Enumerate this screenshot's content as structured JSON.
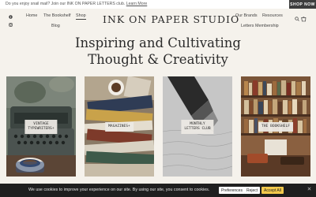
{
  "announcement": {
    "text": "Do you enjoy snail mail? Join our INK ON PAPER LETTERS club.",
    "link": "Learn More"
  },
  "shop_now": "SHOP NOW",
  "nav_left": {
    "home": "Home",
    "bookshelf": "The Bookshelf",
    "shop": "Shop",
    "blog": "Blog"
  },
  "logo": "INK ON PAPER STUDIO",
  "nav_right": {
    "brands": "Our Brands",
    "resources": "Resources",
    "membership": "Letters Membership"
  },
  "cart_count": "0",
  "hero": {
    "line1": "Inspiring and Cultivating",
    "line2": "Thought & Creativity"
  },
  "cards": [
    {
      "line1": "VINTAGE",
      "line2": "TYPEWRITERS+"
    },
    {
      "line1": "MAGAZINES+",
      "line2": ""
    },
    {
      "line1": "MONTHLY",
      "line2": "LETTERS CLUB"
    },
    {
      "line1": "THE BOOKSHELF",
      "line2": ""
    }
  ],
  "cookie": {
    "text": "We use cookies to improve your experience on our site. By using our site, you consent to cookies.",
    "preferences": "Preferences",
    "reject": "Reject",
    "accept": "Accept All"
  },
  "icons": {
    "social_1": "facebook-icon",
    "social_2": "instagram-icon",
    "search": "search-icon",
    "cart": "cart-icon",
    "close": "close-icon"
  }
}
